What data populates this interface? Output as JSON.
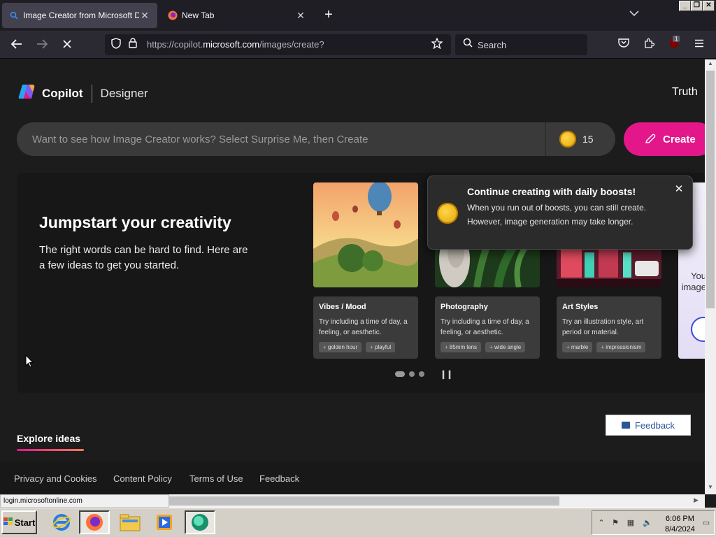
{
  "browser": {
    "tabs": [
      {
        "title": "Image Creator from Microsoft Designer",
        "active": true
      },
      {
        "title": "New Tab",
        "active": false
      }
    ],
    "url": {
      "prefix": "https://copilot.",
      "domain": "microsoft.com",
      "path": "/images/create?"
    },
    "search_placeholder": "Search",
    "extension_badge": "1",
    "window_controls": [
      "_",
      "❐",
      "✕"
    ]
  },
  "page": {
    "brand": "Copilot",
    "product": "Designer",
    "user_label": "Truth",
    "prompt": {
      "placeholder": "Want to see how Image Creator works? Select Surprise Me, then Create",
      "boost_count": "15"
    },
    "create_label": "Create",
    "hero": {
      "title": "Jumpstart your creativity",
      "lead": "The right words can be hard to find. Here are a few ideas to get you started."
    },
    "cards": [
      {
        "title": "Vibes / Mood",
        "desc": "Try including a time of day, a feeling, or aesthetic.",
        "chips": [
          "golden hour",
          "playful"
        ]
      },
      {
        "title": "Photography",
        "desc": "Try including a time of day, a feeling, or aesthetic.",
        "chips": [
          "85mm lens",
          "wide angle"
        ]
      },
      {
        "title": "Art Styles",
        "desc": "Try an illustration style, art period or material.",
        "chips": [
          "marble",
          "impressionism"
        ]
      }
    ],
    "partial_card_text": "You image",
    "carousel": {
      "count": 3,
      "active_index": 0
    },
    "toast": {
      "title": "Continue creating with daily boosts!",
      "body": "When you run out of boosts, you can still create. However, image generation may take longer."
    },
    "explore_label": "Explore ideas",
    "footer_links": [
      "Privacy and Cookies",
      "Content Policy",
      "Terms of Use",
      "Feedback"
    ],
    "feedback_button": "Feedback"
  },
  "status_url": "login.microsoftonline.com",
  "taskbar": {
    "start_label": "Start",
    "time": "6:06 PM",
    "date": "8/4/2024"
  },
  "colors": {
    "accent": "#e3168a",
    "background": "#1c1c1c",
    "panel": "#171717"
  }
}
